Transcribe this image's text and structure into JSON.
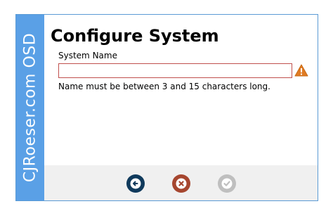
{
  "sidebar": {
    "brand": "CJRoeser.com OSD"
  },
  "page": {
    "title": "Configure System"
  },
  "form": {
    "system_name_label": "System Name",
    "system_name_value": "",
    "error_message": "Name must be between 3 and 15 characters long."
  },
  "footer": {
    "buttons": [
      {
        "icon": "back-arrow-icon",
        "color": "#103a5c",
        "enabled": true
      },
      {
        "icon": "cancel-x-icon",
        "color": "#a6462f",
        "enabled": true
      },
      {
        "icon": "check-icon",
        "color": "#bfbfbf",
        "enabled": false
      }
    ]
  },
  "colors": {
    "sidebar": "#5aa0e6",
    "error_border": "#c0504d",
    "warning": "#e07b24"
  }
}
